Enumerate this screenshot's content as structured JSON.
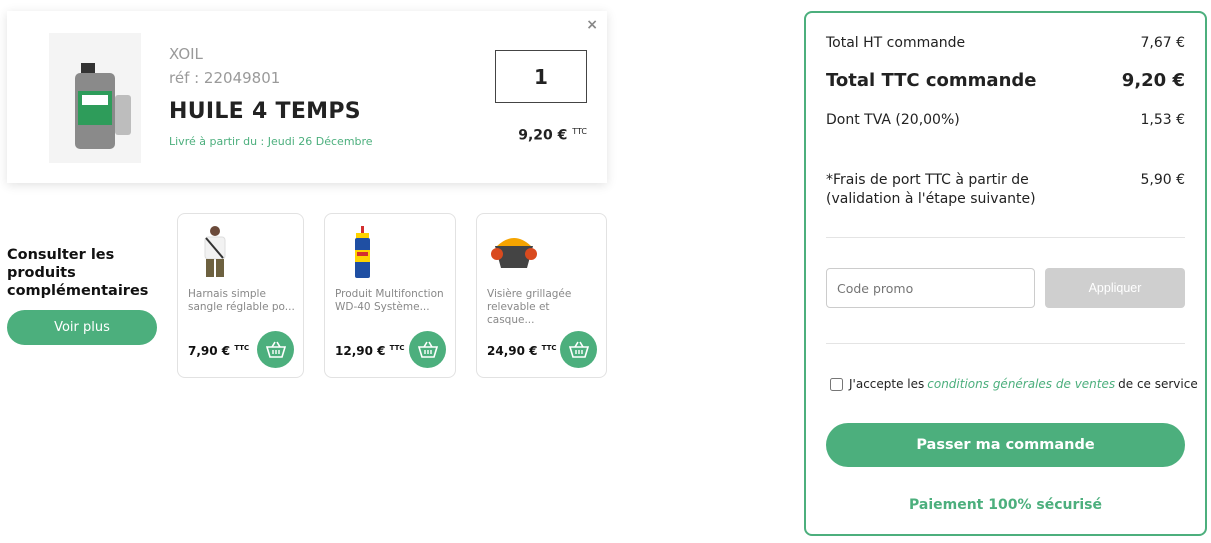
{
  "product": {
    "close_label": "×",
    "brand": "XOIL",
    "ref": "réf : 22049801",
    "name": "HUILE 4 TEMPS",
    "delivery": "Livré à partir du : Jeudi 26 Décembre",
    "quantity": "1",
    "price": "9,20 €",
    "price_suffix": "TTC"
  },
  "complementary": {
    "title": "Consulter les produits complémentaires",
    "voir_plus": "Voir plus",
    "items": [
      {
        "name": "Harnais simple sangle réglable po...",
        "price": "7,90 €",
        "suffix": "TTC",
        "icon": "harness-icon"
      },
      {
        "name": "Produit Multifonction WD-40 Système...",
        "price": "12,90 €",
        "suffix": "TTC",
        "icon": "spray-can-icon"
      },
      {
        "name": "Visière grillagée relevable et casque...",
        "price": "24,90 €",
        "suffix": "TTC",
        "icon": "visor-helmet-icon"
      }
    ]
  },
  "summary": {
    "total_ht_label": "Total HT commande",
    "total_ht_value": "7,67 €",
    "total_ttc_label": "Total TTC commande",
    "total_ttc_value": "9,20 €",
    "tva_label": "Dont TVA (20,00%)",
    "tva_value": "1,53 €",
    "shipping_label": "*Frais de port TTC à partir de (validation à l'étape suivante)",
    "shipping_value": "5,90 €",
    "promo_placeholder": "Code promo",
    "apply_label": "Appliquer",
    "cgv_prefix": "J'accepte les",
    "cgv_link": "conditions générales de ventes",
    "cgv_suffix": "de ce service",
    "order_label": "Passer ma commande",
    "secure_label": "Paiement 100% sécurisé"
  },
  "colors": {
    "accent": "#4caf7d",
    "disabled": "#cfcfcf"
  }
}
